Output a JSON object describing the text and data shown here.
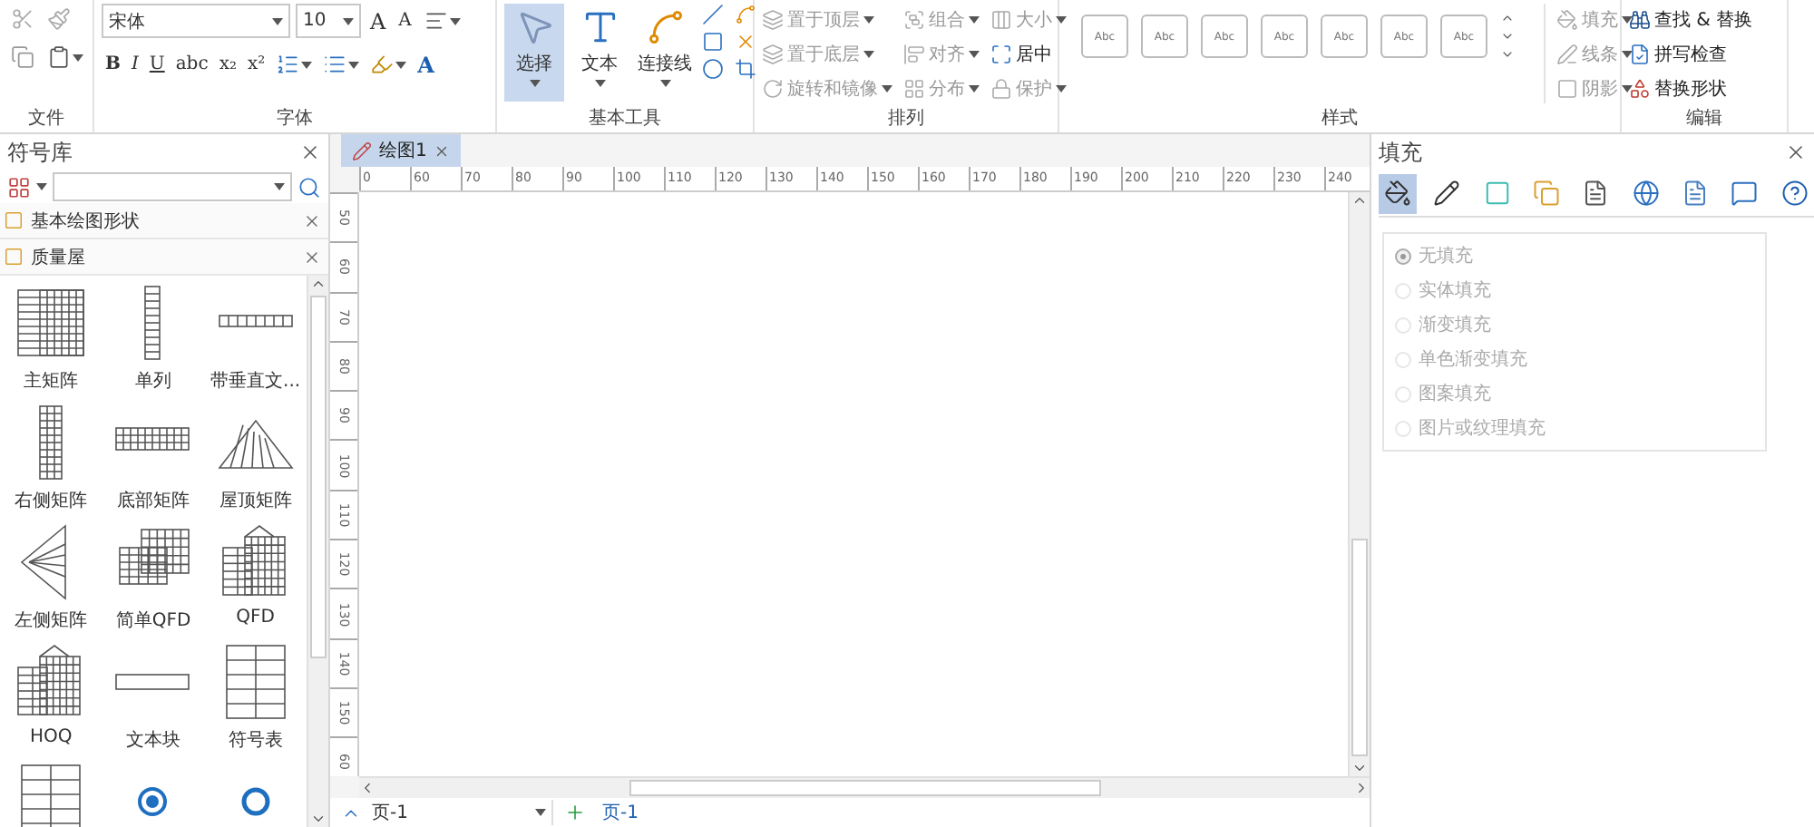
{
  "ribbon": {
    "groups": [
      {
        "kind": "file",
        "label": "文件"
      },
      {
        "kind": "font",
        "label": "字体",
        "font": "宋体",
        "size": "10",
        "grow": "A",
        "shrink": "A",
        "formats": [
          "B",
          "I",
          "U",
          "abc",
          "x₂",
          "x²"
        ],
        "color_letter": "A"
      },
      {
        "kind": "tools",
        "label": "基本工具",
        "tools": [
          {
            "label": "选择",
            "selected": true
          },
          {
            "label": "文本",
            "selected": false
          },
          {
            "label": "连接线",
            "selected": false
          }
        ]
      },
      {
        "kind": "arrange",
        "label": "排列",
        "items": [
          {
            "label": "置于顶层",
            "disabled": true
          },
          {
            "label": "组合",
            "disabled": true
          },
          {
            "label": "大小",
            "disabled": true
          },
          {
            "label": "置于底层",
            "disabled": true
          },
          {
            "label": "对齐",
            "disabled": true
          },
          {
            "label": "居中",
            "disabled": false
          },
          {
            "label": "旋转和镜像",
            "disabled": true
          },
          {
            "label": "分布",
            "disabled": true
          },
          {
            "label": "保护",
            "disabled": true
          }
        ]
      },
      {
        "kind": "styles",
        "label": "样式",
        "tiles": [
          "Abc",
          "Abc",
          "Abc",
          "Abc",
          "Abc",
          "Abc",
          "Abc"
        ],
        "options": [
          {
            "label": "填充",
            "disabled": true
          },
          {
            "label": "线条",
            "disabled": true
          },
          {
            "label": "阴影",
            "disabled": true
          }
        ]
      },
      {
        "kind": "edit",
        "label": "编辑",
        "items": [
          {
            "label": "查找 & 替换",
            "disabled": false
          },
          {
            "label": "拼写检查",
            "disabled": false
          },
          {
            "label": "替换形状",
            "disabled": false
          }
        ]
      }
    ]
  },
  "library": {
    "title": "符号库",
    "sections": [
      {
        "title": "基本绘图形状"
      },
      {
        "title": "质量屋"
      }
    ],
    "shapes": [
      {
        "kind": "matrix",
        "label": "主矩阵"
      },
      {
        "kind": "column",
        "label": "单列"
      },
      {
        "kind": "strip",
        "label": "带垂直文..."
      },
      {
        "kind": "tall",
        "label": "右侧矩阵"
      },
      {
        "kind": "wide",
        "label": "底部矩阵"
      },
      {
        "kind": "roof",
        "label": "屋顶矩阵"
      },
      {
        "kind": "side",
        "label": "左侧矩阵"
      },
      {
        "kind": "qfd",
        "label": "简单QFD"
      },
      {
        "kind": "house",
        "label": "QFD"
      },
      {
        "kind": "house",
        "label": "HOQ"
      },
      {
        "kind": "block",
        "label": "文本块"
      },
      {
        "kind": "table",
        "label": "符号表"
      },
      {
        "kind": "table"
      },
      {
        "kind": "radio"
      },
      {
        "kind": "ring"
      }
    ]
  },
  "document": {
    "tabs": [
      {
        "label": "绘图1",
        "selected": true
      }
    ],
    "hticks": [
      "0",
      "60",
      "70",
      "80",
      "90",
      "100",
      "110",
      "120",
      "130",
      "140",
      "150",
      "160",
      "170",
      "180",
      "190",
      "200",
      "210",
      "220",
      "230",
      "240"
    ],
    "vticks": [
      "50",
      "60",
      "70",
      "80",
      "90",
      "100",
      "110",
      "120",
      "130",
      "140",
      "150",
      "60"
    ],
    "page_selector": "页-1",
    "pages": [
      {
        "label": "页-1",
        "selected": true
      }
    ]
  },
  "fill_panel": {
    "title": "填充",
    "tabs": [
      {
        "selected": true
      },
      {
        "selected": false
      },
      {
        "selected": false
      },
      {
        "selected": false
      },
      {
        "selected": false
      },
      {
        "selected": false
      },
      {
        "selected": false
      },
      {
        "selected": false
      },
      {
        "selected": false
      }
    ],
    "options": [
      {
        "label": "无填充",
        "selected": true,
        "disabled": true
      },
      {
        "label": "实体填充",
        "selected": false,
        "disabled": true
      },
      {
        "label": "渐变填充",
        "selected": false,
        "disabled": true
      },
      {
        "label": "单色渐变填充",
        "selected": false,
        "disabled": true
      },
      {
        "label": "图案填充",
        "selected": false,
        "disabled": true
      },
      {
        "label": "图片或纹理填充",
        "selected": false,
        "disabled": true
      }
    ]
  }
}
